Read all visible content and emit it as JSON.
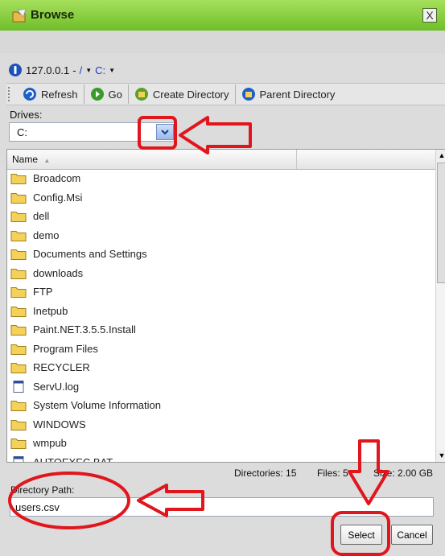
{
  "window": {
    "title": "Browse",
    "close_label": "X"
  },
  "breadcrumb": {
    "host": "127.0.0.1",
    "sep": "-",
    "root": "/",
    "drive": "C:"
  },
  "toolbar": {
    "refresh": "Refresh",
    "go": "Go",
    "create_dir": "Create Directory",
    "parent_dir": "Parent Directory"
  },
  "drives": {
    "label": "Drives:",
    "value": "C:"
  },
  "grid": {
    "column_name": "Name",
    "rows": [
      "Broadcom",
      "Config.Msi",
      "dell",
      "demo",
      "Documents and Settings",
      "downloads",
      "FTP",
      "Inetpub",
      "Paint.NET.3.5.5.Install",
      "Program Files",
      "RECYCLER",
      "ServU.log",
      "System Volume Information",
      "WINDOWS",
      "wmpub",
      "AUTOEXEC.BAT"
    ]
  },
  "status": {
    "directories": "Directories: 15",
    "files": "Files: 5",
    "size": "Size: 2.00 GB"
  },
  "directory_path": {
    "label": "Directory Path:",
    "value": "users.csv"
  },
  "buttons": {
    "select": "Select",
    "cancel": "Cancel"
  },
  "colors": {
    "title_green": "#8fd04a",
    "annotation_red": "#e0161c",
    "link_blue": "#1a3cc8",
    "folder_yellow": "#f4d25a"
  }
}
